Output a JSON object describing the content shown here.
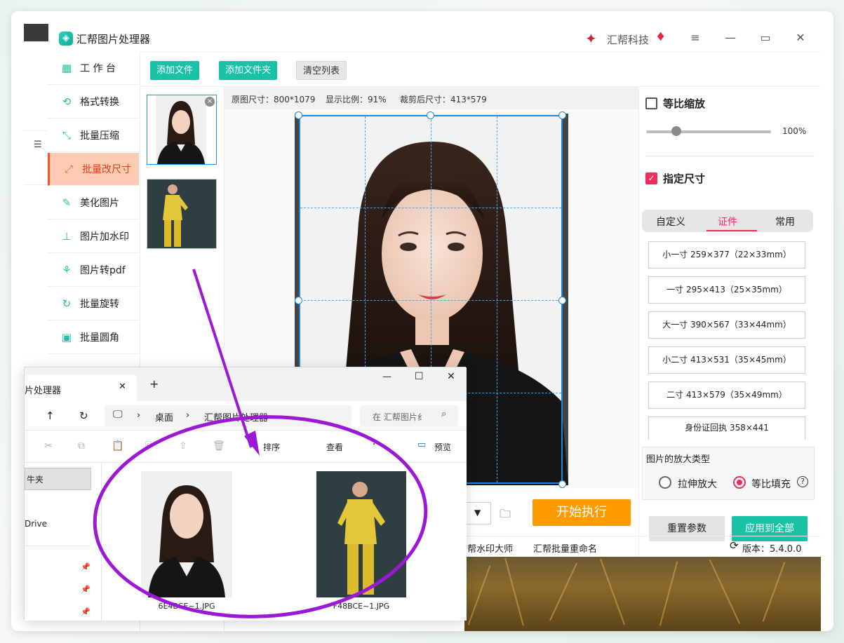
{
  "app": {
    "title": "汇帮图片处理器",
    "logo_glyph": "◈",
    "brand_name": "汇帮科技",
    "brand_glyph": "✦",
    "vip_glyph": "♦",
    "controls": {
      "menu": "≡",
      "minimize": "—",
      "maximize": "▭",
      "close": "✕"
    },
    "accent": "#19c2a5",
    "active_color": "#e23b1b"
  },
  "sidebar": {
    "list_icon": "☰",
    "items": [
      {
        "label": "工 作 台",
        "icon": "▦",
        "active": false
      },
      {
        "label": "格式转换",
        "icon": "⟲",
        "active": false
      },
      {
        "label": "批量压缩",
        "icon": "⤡",
        "active": false
      },
      {
        "label": "批量改尺寸",
        "icon": "⤢",
        "active": true
      },
      {
        "label": "美化图片",
        "icon": "✎",
        "active": false
      },
      {
        "label": "图片加水印",
        "icon": "⊥",
        "active": false
      },
      {
        "label": "图片转pdf",
        "icon": "⚘",
        "active": false
      },
      {
        "label": "批量旋转",
        "icon": "↻",
        "active": false
      },
      {
        "label": "批量圆角",
        "icon": "▣",
        "active": false
      }
    ]
  },
  "toolbar": {
    "add_file": "添加文件",
    "add_folder": "添加文件夹",
    "clear_list": "清空列表"
  },
  "thumbs": {
    "close": "×"
  },
  "infobar": {
    "original": "原图尺寸：800*1079",
    "ratio": "显示比例：91%",
    "cropped": "裁剪后尺寸：413*579"
  },
  "right_panel": {
    "proportional_label": "等比缩放",
    "slider_value": "100%",
    "slider_fraction": 0.2,
    "specify_label": "指定尺寸",
    "check_mark": "✓",
    "tabs": [
      "自定义",
      "证件",
      "常用"
    ],
    "active_tab": "证件",
    "sizes": [
      "小一寸 259×377（22×33mm）",
      "一寸 295×413（25×35mm）",
      "大一寸 390×567（33×44mm）",
      "小二寸 413×531（35×45mm）",
      "二寸 413×579（35×49mm）",
      "身份证回执 358×441"
    ],
    "zoom_type_title": "图片的放大类型",
    "zoom_options": [
      "拉伸放大",
      "等比填充"
    ],
    "help_glyph": "?",
    "reset": "重置参数",
    "apply_all": "应用到全部"
  },
  "actions": {
    "start": "开始执行",
    "dropdown_arrow": "▼",
    "folder_icon": "🗀"
  },
  "bottom": {
    "link1": "帮水印大师",
    "link2": "汇帮批量重命名",
    "refresh_glyph": "⟳",
    "version": "版本：5.4.0.0"
  },
  "explorer": {
    "tab_title": "片处理器",
    "tab_close": "✕",
    "new_tab": "+",
    "win_min": "—",
    "win_max": "☐",
    "win_close": "✕",
    "up": "↑",
    "refresh": "↻",
    "pc_icon": "🖵",
    "sep": "›",
    "crumb1": "桌面",
    "crumb2": "汇帮图片处理器",
    "search_placeholder": "在 汇帮图片纟",
    "search_icon": "⌕",
    "cmd_icons": [
      "✂",
      "⧉",
      "📋",
      "⎘",
      "⇪",
      "🗑"
    ],
    "sort": "排序",
    "view": "查看",
    "more": "···",
    "preview": "预览",
    "preview_icon": "▭",
    "nav_selected": "牛夹",
    "nav_drive": "Drive",
    "pin_glyph": "📌",
    "files": [
      "6E4BCE~1.JPG",
      "F48BCE~1.JPG"
    ]
  }
}
